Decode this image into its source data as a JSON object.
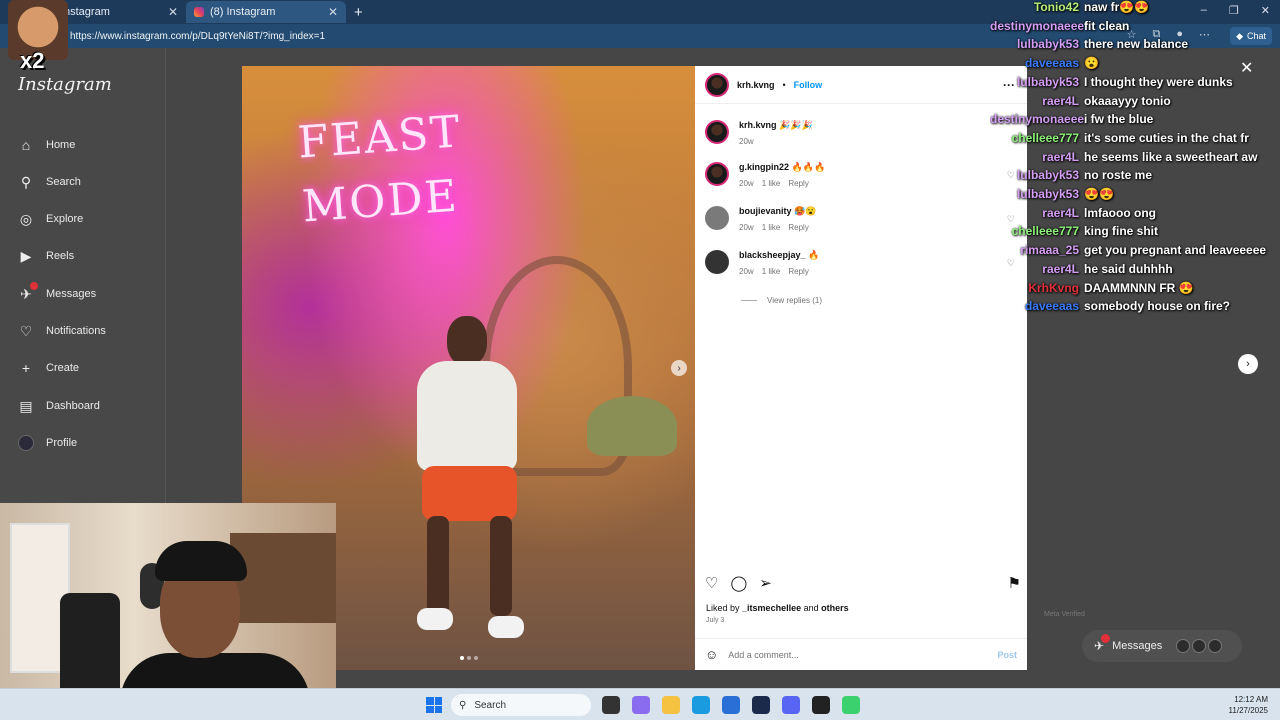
{
  "browser": {
    "tabs": [
      {
        "label": "nstagram",
        "active": false
      },
      {
        "label": "(8) Instagram",
        "active": true
      }
    ],
    "new_tab": "+",
    "url": "https://www.instagram.com/p/DLq9tYeNi8T/?img_index=1",
    "chat_label": "Chat",
    "window_controls": [
      "–",
      "❐",
      "✕"
    ]
  },
  "instagram": {
    "logo": "Instagram",
    "nav": [
      {
        "label": "Home",
        "icon": "home-icon",
        "glyph": "⌂"
      },
      {
        "label": "Search",
        "icon": "search-icon",
        "glyph": "⚲"
      },
      {
        "label": "Explore",
        "icon": "compass-icon",
        "glyph": "◎"
      },
      {
        "label": "Reels",
        "icon": "reels-icon",
        "glyph": "▶"
      },
      {
        "label": "Messages",
        "icon": "messenger-icon",
        "glyph": "✈",
        "badge": true
      },
      {
        "label": "Notifications",
        "icon": "heart-icon",
        "glyph": "♡"
      },
      {
        "label": "Create",
        "icon": "plus-icon",
        "glyph": "+"
      },
      {
        "label": "Dashboard",
        "icon": "dashboard-icon",
        "glyph": "▤"
      },
      {
        "label": "Profile",
        "icon": "profile-avatar",
        "glyph": ""
      }
    ],
    "post": {
      "author": "krh.kvng",
      "follow": "Follow",
      "separator": "•",
      "more": "···",
      "neon_text": "FEAST MODE",
      "caption": {
        "user": "krh.kvng",
        "text": "🎉🎉🎉",
        "age": "20w"
      },
      "comments": [
        {
          "user": "g.kingpin22",
          "text": "🔥🔥🔥",
          "age": "20w",
          "likes": "1 like",
          "reply": "Reply"
        },
        {
          "user": "boujievanity",
          "text": "🥵😮",
          "age": "20w",
          "likes": "1 like",
          "reply": "Reply"
        },
        {
          "user": "blacksheepjay_",
          "text": "🔥",
          "age": "20w",
          "likes": "1 like",
          "reply": "Reply"
        }
      ],
      "view_replies": "View replies (1)",
      "liked_by_prefix": "Liked by",
      "liked_by_user": "_itsmechellee",
      "liked_by_and": "and",
      "liked_by_others": "others",
      "date": "July 3",
      "add_comment_placeholder": "Add a comment...",
      "post_button": "Post"
    },
    "meta_verified": "Meta Verified",
    "messages_pill": "Messages"
  },
  "stream_chat": [
    {
      "user": "Tonio42",
      "color": "#b6f07a",
      "msg": "naw fr😍😍"
    },
    {
      "user": "destinymonaeee",
      "color": "#d59ef5",
      "msg": "fit clean"
    },
    {
      "user": "lulbabyk53",
      "color": "#d59ef5",
      "msg": "there new balance"
    },
    {
      "user": "daveeaas",
      "color": "#3a7bff",
      "msg": "😮"
    },
    {
      "user": "lulbabyk53",
      "color": "#d59ef5",
      "msg": "I thought they were dunks"
    },
    {
      "user": "raer4L",
      "color": "#d59ef5",
      "msg": "okaaayyy tonio"
    },
    {
      "user": "destinymonaeee",
      "color": "#d59ef5",
      "msg": "i fw the blue"
    },
    {
      "user": "chelleee777",
      "color": "#8df27a",
      "msg": "it's some cuties in the chat fr"
    },
    {
      "user": "raer4L",
      "color": "#d59ef5",
      "msg": "he seems like a sweetheart aw"
    },
    {
      "user": "lulbabyk53",
      "color": "#d59ef5",
      "msg": "no roste me"
    },
    {
      "user": "lulbabyk53",
      "color": "#d59ef5",
      "msg": "😍😍"
    },
    {
      "user": "raer4L",
      "color": "#d59ef5",
      "msg": "lmfaooo ong"
    },
    {
      "user": "chelleee777",
      "color": "#8df27a",
      "msg": "king fine shit"
    },
    {
      "user": "rimaaa_25",
      "color": "#d59ef5",
      "msg": "get you pregnant and leaveeeee"
    },
    {
      "user": "raer4L",
      "color": "#d59ef5",
      "msg": "he said duhhhh"
    },
    {
      "user": "KrhKvng",
      "color": "#e0303a",
      "msg": "DAAMMNNN FR 😍"
    },
    {
      "user": "daveeaas",
      "color": "#3a7bff",
      "msg": "somebody house on fire?"
    }
  ],
  "overlay": {
    "emote_text": "x2"
  },
  "taskbar": {
    "search": "Search",
    "time": "12:12 AM",
    "date": "11/27/2025",
    "icons": [
      {
        "name": "task-view-icon",
        "color": "#333333"
      },
      {
        "name": "copilot-icon",
        "color": "#8a6cf0"
      },
      {
        "name": "file-explorer-icon",
        "color": "#f5c242"
      },
      {
        "name": "edge-icon",
        "color": "#1a9be0"
      },
      {
        "name": "store-icon",
        "color": "#2a6fd6"
      },
      {
        "name": "app-icon",
        "color": "#1b2a4a"
      },
      {
        "name": "discord-icon",
        "color": "#5865f2"
      },
      {
        "name": "terminal-icon",
        "color": "#222222"
      },
      {
        "name": "obs-icon",
        "color": "#3bd16f"
      }
    ]
  }
}
